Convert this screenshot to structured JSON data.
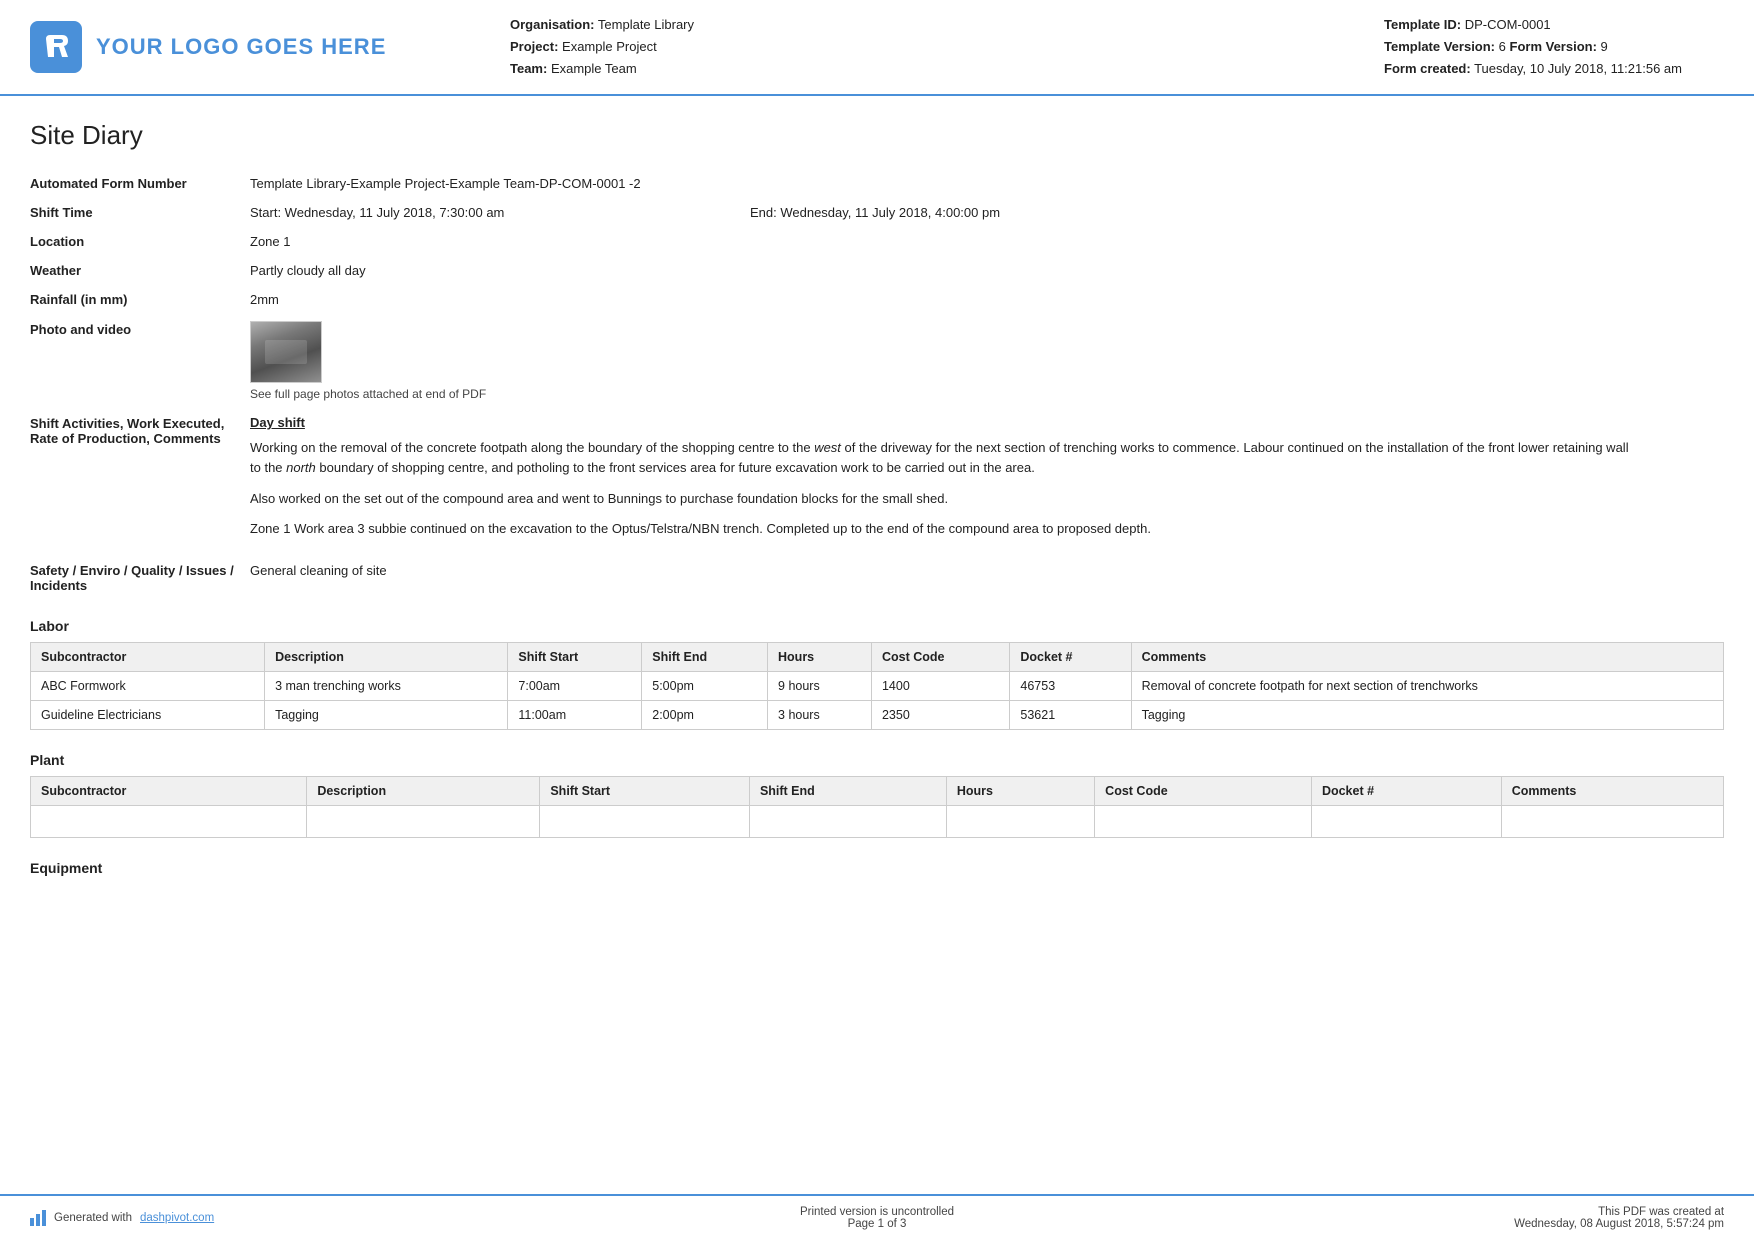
{
  "header": {
    "logo_text": "YOUR LOGO GOES HERE",
    "org_label": "Organisation:",
    "org_value": "Template Library",
    "project_label": "Project:",
    "project_value": "Example Project",
    "team_label": "Team:",
    "team_value": "Example Team",
    "template_id_label": "Template ID:",
    "template_id_value": "DP-COM-0001",
    "template_version_label": "Template Version:",
    "template_version_value": "6",
    "form_version_label": "Form Version:",
    "form_version_value": "9",
    "form_created_label": "Form created:",
    "form_created_value": "Tuesday, 10 July 2018, 11:21:56 am"
  },
  "page": {
    "title": "Site Diary"
  },
  "form_fields": {
    "automated_form_label": "Automated Form Number",
    "automated_form_value": "Template Library-Example Project-Example Team-DP-COM-0001   -2",
    "shift_time_label": "Shift Time",
    "shift_start_value": "Start: Wednesday, 11 July 2018, 7:30:00 am",
    "shift_end_value": "End: Wednesday, 11 July 2018, 4:00:00 pm",
    "location_label": "Location",
    "location_value": "Zone 1",
    "weather_label": "Weather",
    "weather_value": "Partly cloudy all day",
    "rainfall_label": "Rainfall (in mm)",
    "rainfall_value": "2mm",
    "photo_video_label": "Photo and video",
    "photo_caption": "See full page photos attached at end of PDF",
    "activity_label": "Shift Activities, Work Executed, Rate of Production, Comments",
    "activity_heading": "Day shift",
    "activity_para1": "Working on the removal of the concrete footpath along the boundary of the shopping centre to the west of the driveway for the next section of trenching works to commence. Labour continued on the installation of the front lower retaining wall to the north boundary of shopping centre, and potholing to the front services area for future excavation work to be carried out in the area.",
    "activity_para1_italic1": "west",
    "activity_para1_italic2": "north",
    "activity_para2": "Also worked on the set out of the compound area and went to Bunnings to purchase foundation blocks for the small shed.",
    "activity_para3": "Zone 1 Work area 3 subbie continued on the excavation to the Optus/Telstra/NBN trench. Completed up to the end of the compound area to proposed depth.",
    "safety_label": "Safety / Enviro / Quality / Issues / Incidents",
    "safety_value": "General cleaning of site"
  },
  "labor": {
    "section_title": "Labor",
    "columns": [
      "Subcontractor",
      "Description",
      "Shift Start",
      "Shift End",
      "Hours",
      "Cost Code",
      "Docket #",
      "Comments"
    ],
    "rows": [
      {
        "subcontractor": "ABC Formwork",
        "description": "3 man trenching works",
        "shift_start": "7:00am",
        "shift_end": "5:00pm",
        "hours": "9 hours",
        "cost_code": "1400",
        "docket": "46753",
        "comments": "Removal of concrete footpath for next section of trenchworks"
      },
      {
        "subcontractor": "Guideline Electricians",
        "description": "Tagging",
        "shift_start": "11:00am",
        "shift_end": "2:00pm",
        "hours": "3 hours",
        "cost_code": "2350",
        "docket": "53621",
        "comments": "Tagging"
      }
    ]
  },
  "plant": {
    "section_title": "Plant",
    "columns": [
      "Subcontractor",
      "Description",
      "Shift Start",
      "Shift End",
      "Hours",
      "Cost Code",
      "Docket #",
      "Comments"
    ],
    "rows": []
  },
  "equipment": {
    "section_title": "Equipment"
  },
  "footer": {
    "generated_label": "Generated with",
    "generated_link": "dashpivot.com",
    "center_line1": "Printed version is uncontrolled",
    "center_line2": "Page 1 of 3",
    "right_line1": "This PDF was created at",
    "right_line2": "Wednesday, 08 August 2018, 5:57:24 pm"
  }
}
